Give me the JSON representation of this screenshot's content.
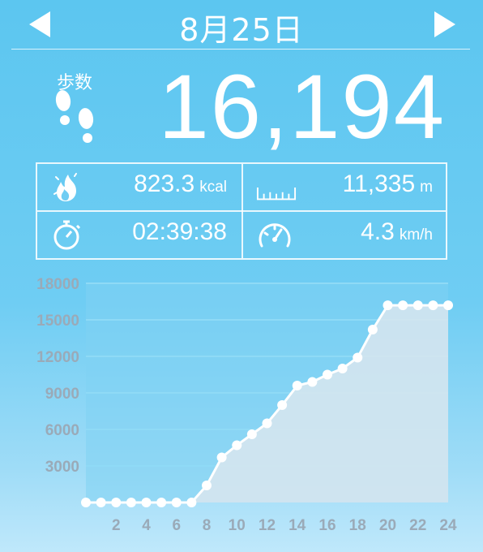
{
  "header": {
    "date": "8月25日",
    "prev_icon": "chevron-left-icon",
    "next_icon": "chevron-right-icon"
  },
  "steps": {
    "label": "歩数",
    "value": "16,194",
    "icon": "footprints-icon"
  },
  "stats": {
    "calories": {
      "value": "823.3",
      "unit": "kcal",
      "icon": "flame-icon"
    },
    "distance": {
      "value": "11,335",
      "unit": "m",
      "icon": "ruler-icon"
    },
    "duration": {
      "value": "02:39:38",
      "unit": "",
      "icon": "stopwatch-icon"
    },
    "speed": {
      "value": "4.3",
      "unit": "km/h",
      "icon": "speedometer-icon"
    }
  },
  "colors": {
    "background": "#5cc6f0",
    "text": "#ffffff",
    "chart_axis_text": "#9aaab8",
    "chart_fill": "#d9e6ee"
  },
  "chart_data": {
    "type": "line",
    "title": "",
    "xlabel": "",
    "ylabel": "",
    "x_ticks": [
      2,
      4,
      6,
      8,
      10,
      12,
      14,
      16,
      18,
      20,
      22,
      24
    ],
    "y_ticks": [
      3000,
      6000,
      9000,
      12000,
      15000,
      18000
    ],
    "xlim": [
      0,
      24
    ],
    "ylim": [
      0,
      18000
    ],
    "x": [
      0,
      1,
      2,
      3,
      4,
      5,
      6,
      7,
      8,
      9,
      10,
      11,
      12,
      13,
      14,
      15,
      16,
      17,
      18,
      19,
      20,
      21,
      22,
      23,
      24
    ],
    "y": [
      0,
      0,
      0,
      0,
      0,
      0,
      0,
      0,
      1400,
      3700,
      4700,
      5600,
      6500,
      8000,
      9600,
      9900,
      10500,
      11000,
      11900,
      14200,
      16194,
      16194,
      16194,
      16194,
      16194
    ],
    "grid": true,
    "legend": "none"
  }
}
